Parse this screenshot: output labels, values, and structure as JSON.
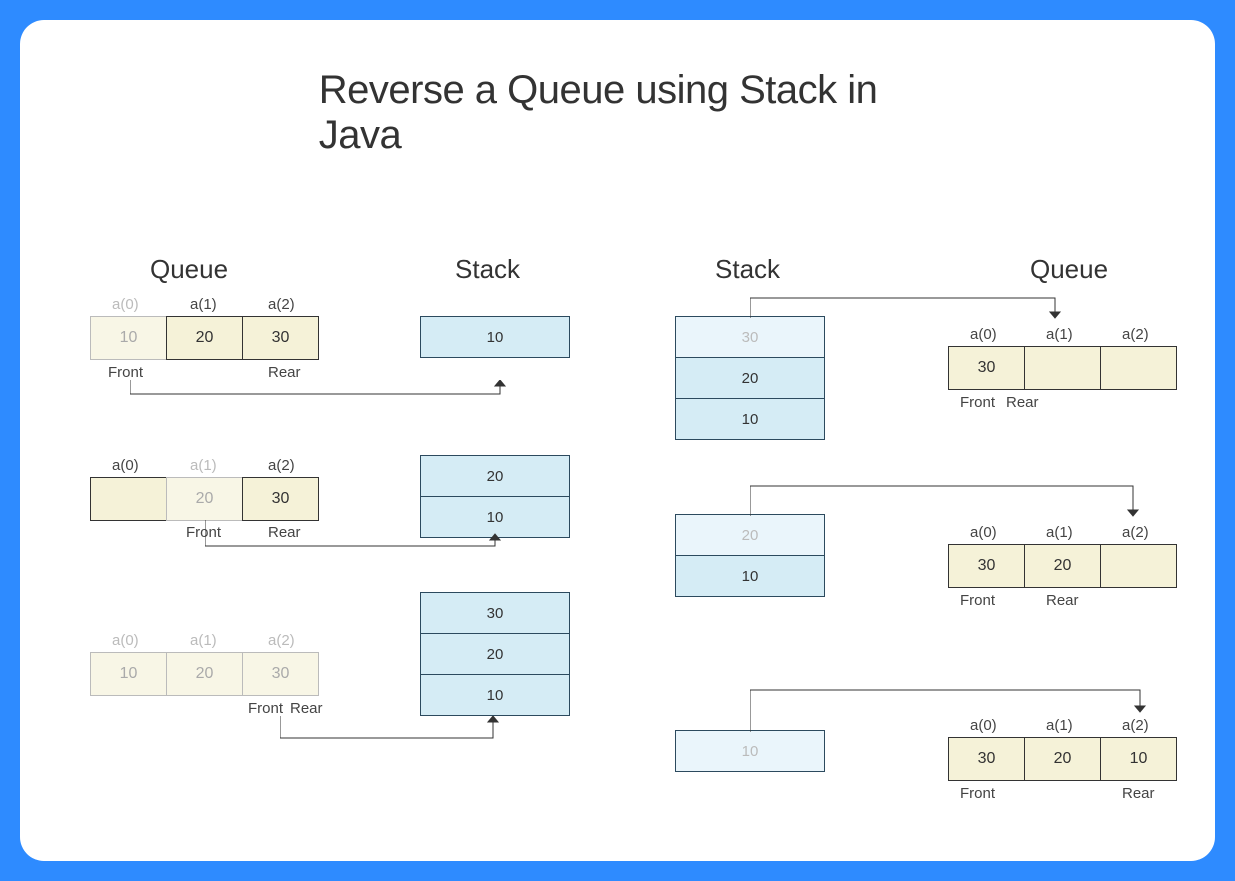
{
  "title": "Reverse a Queue using Stack in Java",
  "labels": {
    "queue_left": "Queue",
    "stack_left": "Stack",
    "stack_right": "Stack",
    "queue_right": "Queue",
    "front": "Front",
    "rear": "Rear"
  },
  "idx": {
    "a0": "a(0)",
    "a1": "a(1)",
    "a2": "a(2)"
  },
  "left": {
    "step1": {
      "queue": [
        "10",
        "20",
        "30"
      ],
      "stack": [
        "10"
      ]
    },
    "step2": {
      "queue": [
        "",
        "20",
        "30"
      ],
      "stack": [
        "20",
        "10"
      ]
    },
    "step3": {
      "queue": [
        "10",
        "20",
        "30"
      ],
      "stack": [
        "30",
        "20",
        "10"
      ]
    }
  },
  "right": {
    "step1": {
      "stack": [
        "30",
        "20",
        "10"
      ],
      "queue": [
        "30",
        "",
        ""
      ]
    },
    "step2": {
      "stack": [
        "20",
        "10"
      ],
      "queue": [
        "30",
        "20",
        ""
      ]
    },
    "step3": {
      "stack": [
        "10"
      ],
      "queue": [
        "30",
        "20",
        "10"
      ]
    }
  }
}
